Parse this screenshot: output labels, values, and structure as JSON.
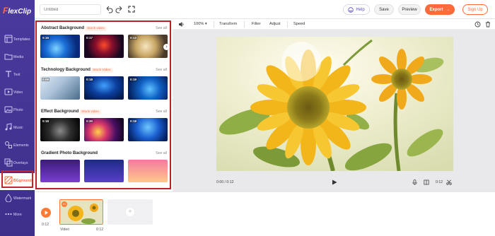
{
  "app": {
    "logo_text": "lexClip",
    "logo_initial": "F"
  },
  "colors": {
    "accent": "#ff6a3d",
    "nav_bg": "#4b3a9e",
    "highlight": "#b9222b"
  },
  "nav": {
    "items": [
      {
        "label": "Templates",
        "icon": "templates-icon"
      },
      {
        "label": "Media",
        "icon": "media-icon"
      },
      {
        "label": "Text",
        "icon": "text-icon"
      },
      {
        "label": "Video",
        "icon": "video-icon"
      },
      {
        "label": "Photo",
        "icon": "photo-icon"
      },
      {
        "label": "Music",
        "icon": "music-icon"
      },
      {
        "label": "Elements",
        "icon": "elements-icon"
      },
      {
        "label": "Overlays",
        "icon": "overlays-icon"
      },
      {
        "label": "BGground",
        "icon": "background-icon"
      },
      {
        "label": "Watermark",
        "icon": "watermark-icon"
      },
      {
        "label": "More",
        "icon": "more-icon"
      }
    ],
    "active": "BGground"
  },
  "topbar": {
    "title_placeholder": "Untitled",
    "help": "Help",
    "save": "Save",
    "preview": "Preview",
    "export": "Export",
    "export_arrow": "→",
    "signup": "Sign Up"
  },
  "panel": {
    "see_all": "See all",
    "sections": [
      {
        "title": "Abstract Background",
        "badge": "Stock video",
        "durations": [
          "0:16",
          "0:17",
          "0:13"
        ]
      },
      {
        "title": "Technology Background",
        "badge": "Stock Video",
        "durations": [
          "0:08",
          "0:18",
          "0:19"
        ]
      },
      {
        "title": "Effect Background",
        "badge": "Stock video",
        "durations": [
          "0:18",
          "0:30",
          "0:18"
        ]
      },
      {
        "title": "Gradient Photo Background",
        "badge": "",
        "durations": []
      }
    ]
  },
  "editor_toolbar": {
    "zoom": "100%",
    "transform": "Transform",
    "filter": "Filter",
    "adjust": "Adjust",
    "speed": "Speed"
  },
  "player": {
    "current_time": "0:00 / 0:12",
    "duration_right": "0:12"
  },
  "timeline": {
    "total_time": "0:12",
    "clip_label": "Video",
    "clip_duration": "0:12",
    "clip_badge": "01"
  }
}
